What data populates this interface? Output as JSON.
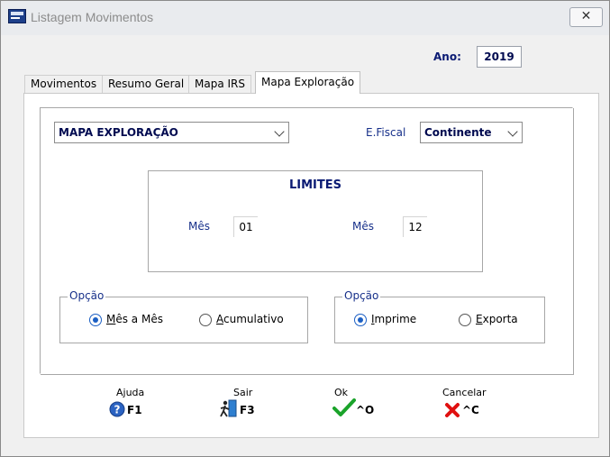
{
  "window": {
    "title": "Listagem Movimentos",
    "close_glyph": "✕"
  },
  "header": {
    "ano_label": "Ano:",
    "ano_value": "2019"
  },
  "tabs": [
    {
      "label": "Movimentos",
      "active": false
    },
    {
      "label": "Resumo Geral",
      "active": false
    },
    {
      "label": "Mapa IRS",
      "active": false
    },
    {
      "label": "Mapa Exploração",
      "active": true
    }
  ],
  "report_select": {
    "value": "MAPA EXPLORAÇÃO"
  },
  "efiscal": {
    "label": "E.Fiscal",
    "value": "Continente"
  },
  "limites": {
    "title": "LIMITES",
    "from_label": "Mês",
    "from_value": "01",
    "to_label": "Mês",
    "to_value": "12"
  },
  "opcao_periodo": {
    "legend": "Opção",
    "options": [
      {
        "pre": "",
        "u": "M",
        "post": "ês a Mês",
        "checked": true
      },
      {
        "pre": "",
        "u": "A",
        "post": "cumulativo",
        "checked": false
      }
    ]
  },
  "opcao_saida": {
    "legend": "Opção",
    "options": [
      {
        "pre": "",
        "u": "I",
        "post": "mprime",
        "checked": true
      },
      {
        "pre": "",
        "u": "E",
        "post": "xporta",
        "checked": false
      }
    ]
  },
  "buttons": {
    "ajuda": {
      "label": "Ajuda",
      "key": "F1",
      "icon": "help-icon"
    },
    "sair": {
      "label": "Sair",
      "key": "F3",
      "icon": "exit-door-icon"
    },
    "ok": {
      "label": "Ok",
      "key": "^O",
      "icon": "checkmark-icon"
    },
    "cancelar": {
      "label": "Cancelar",
      "key": "^C",
      "icon": "red-x-icon"
    }
  },
  "colors": {
    "label_blue": "#17308a",
    "check_green": "#1aa32a",
    "cancel_red": "#e01010",
    "radio_blue": "#1b5fc4"
  }
}
